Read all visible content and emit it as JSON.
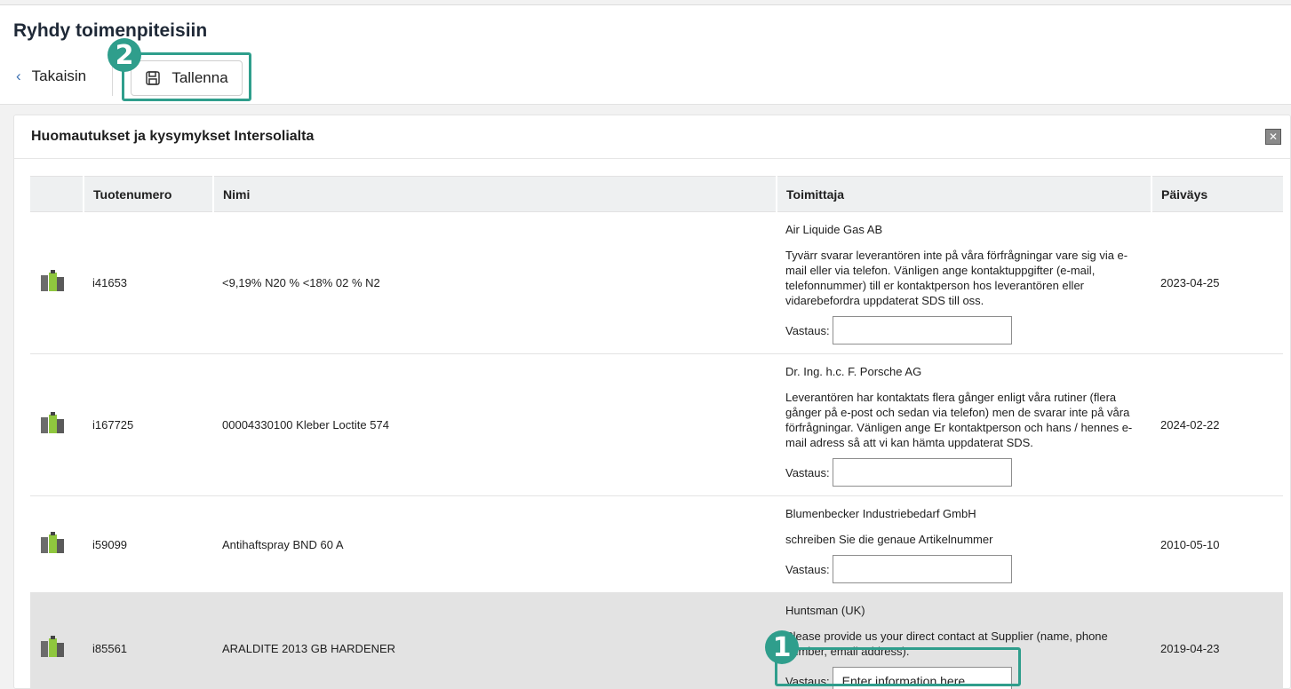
{
  "header": {
    "title": "Ryhdy toimenpiteisiin",
    "back_label": "Takaisin",
    "save_label": "Tallenna"
  },
  "panel": {
    "title": "Huomautukset ja kysymykset Intersolialta"
  },
  "table": {
    "columns": [
      "",
      "Tuotenumero",
      "Nimi",
      "Toimittaja",
      "Päiväys"
    ],
    "answer_label": "Vastaus:",
    "rows": [
      {
        "product_no": "i41653",
        "name": "<9,19% N20 % <18% 02 % N2",
        "supplier": "Air Liquide Gas AB",
        "message": "Tyvärr svarar leverantören inte på våra förfrågningar vare sig via e-mail eller via telefon. Vänligen ange kontaktuppgifter (e-mail, telefonnummer) till er kontaktperson hos leverantören eller vidarebefordra uppdaterat SDS till oss.",
        "answer": "",
        "date": "2023-04-25"
      },
      {
        "product_no": "i167725",
        "name": "00004330100 Kleber Loctite 574",
        "supplier": "Dr. Ing. h.c. F. Porsche AG",
        "message": "Leverantören har kontaktats flera gånger enligt våra rutiner (flera gånger på e-post och sedan via telefon) men de svarar inte på våra förfrågningar. Vänligen ange Er kontaktperson och hans / hennes e-mail adress så att vi kan hämta uppdaterat SDS.",
        "answer": "",
        "date": "2024-02-22"
      },
      {
        "product_no": "i59099",
        "name": "Antihaftspray BND 60 A",
        "supplier": "Blumenbecker Industriebedarf GmbH",
        "message": "schreiben Sie die genaue Artikelnummer",
        "answer": "",
        "date": "2010-05-10"
      },
      {
        "product_no": "i85561",
        "name": "ARALDITE 2013 GB HARDENER",
        "supplier": "Huntsman (UK)",
        "message": "Please provide us your direct contact at Supplier (name, phone number, email address).",
        "answer": "Enter information here...",
        "date": "2019-04-23"
      }
    ]
  },
  "callouts": [
    "1",
    "2"
  ],
  "icons": {
    "back": "chevron-left-icon",
    "save": "floppy-disk-icon",
    "close": "close-icon",
    "product": "chemical-product-icon"
  },
  "colors": {
    "callout": "#2f9e8c",
    "highlight_row": "#e3e3e3",
    "header_bg": "#eef0f1"
  }
}
